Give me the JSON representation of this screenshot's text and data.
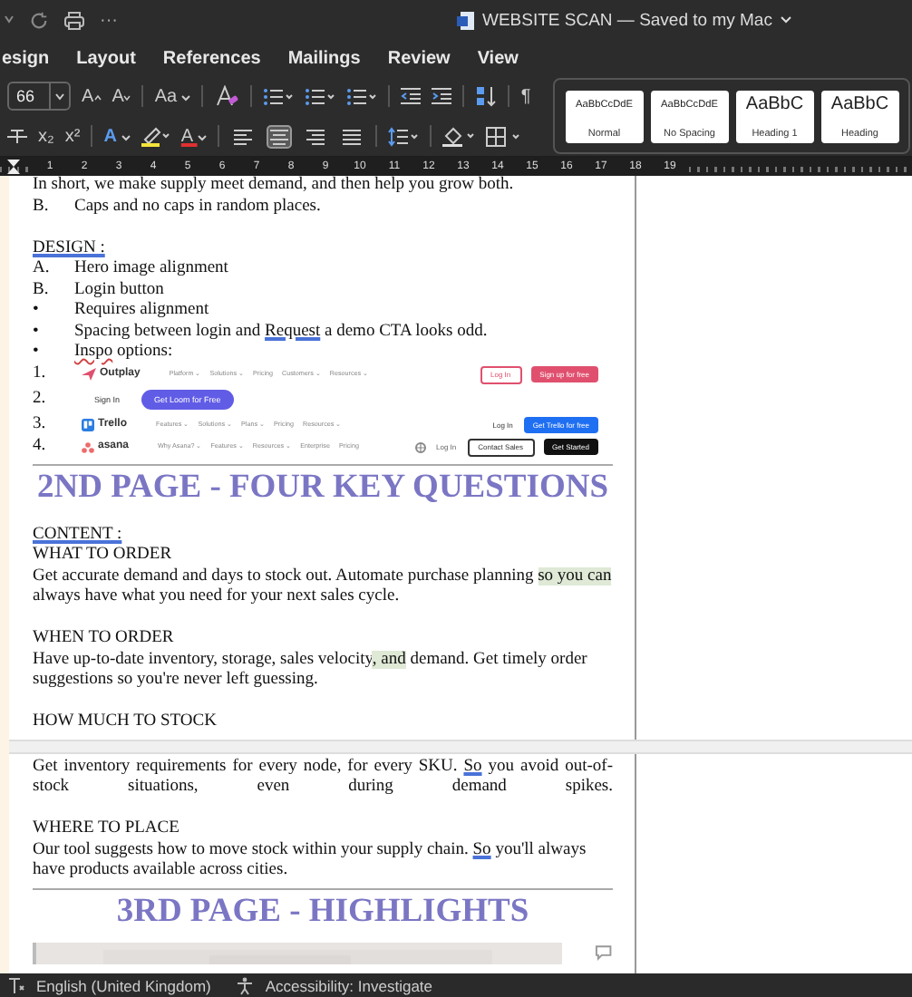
{
  "title_bar": {
    "more": "···",
    "title": "WEBSITE SCAN — Saved to my Mac"
  },
  "menu_tabs": [
    "esign",
    "Layout",
    "References",
    "Mailings",
    "Review",
    "View"
  ],
  "ribbon": {
    "font_size": "66",
    "grow_font": "A",
    "shrink_font": "A",
    "change_case": "Aa",
    "subscript": "x₂",
    "superscript": "x²",
    "text_effects": "A",
    "font_color": "A",
    "show_marks": "¶",
    "alignment": [
      {
        "selected": false
      },
      {
        "selected": true
      },
      {
        "selected": false
      },
      {
        "selected": false
      }
    ],
    "styles": [
      {
        "preview": "AaBbCcDdE",
        "name": "Normal"
      },
      {
        "preview": "AaBbCcDdE",
        "name": "No Spacing"
      },
      {
        "preview": "AaBbC",
        "name": "Heading 1"
      },
      {
        "preview": "AaBbC",
        "name": "Heading"
      }
    ]
  },
  "ruler": [
    "1",
    "2",
    "3",
    "4",
    "5",
    "6",
    "7",
    "8",
    "9",
    "10",
    "11",
    "12",
    "13",
    "14",
    "15",
    "16",
    "17",
    "18",
    "19"
  ],
  "document": [
    {
      "kind": "cut_line",
      "segments": [
        {
          "text": "In short, we make supply meet demand, and then help you grow both."
        }
      ]
    },
    {
      "kind": "list",
      "marker": "B.",
      "segments": [
        {
          "text": "Caps and no caps in random places."
        }
      ]
    },
    {
      "kind": "gap"
    },
    {
      "kind": "para",
      "segments": [
        {
          "text": "DESIGN :",
          "underline": true
        }
      ]
    },
    {
      "kind": "list",
      "marker": "A.",
      "segments": [
        {
          "text": "Hero image alignment"
        }
      ]
    },
    {
      "kind": "list",
      "marker": "B.",
      "segments": [
        {
          "text": "Login button"
        }
      ]
    },
    {
      "kind": "list",
      "marker": "•",
      "segments": [
        {
          "text": "Requires alignment"
        }
      ]
    },
    {
      "kind": "list",
      "marker": "•",
      "segments": [
        {
          "text": "Spacing between login and "
        },
        {
          "text": "Request",
          "flag": true
        },
        {
          "text": " a demo CTA looks odd."
        }
      ]
    },
    {
      "kind": "list",
      "marker": "•",
      "segments": [
        {
          "text": "Inspo",
          "spell": true
        },
        {
          "text": " options:"
        }
      ]
    },
    {
      "kind": "inspo",
      "items": [
        {
          "marker": "1.",
          "logo": "Outplay",
          "nav": [
            "Platform ⌄",
            "Solutions ⌄",
            "Pricing",
            "Customers ⌄",
            "Resources ⌄"
          ],
          "buttons": [
            "Log In",
            "Sign up for free"
          ]
        },
        {
          "marker": "2.",
          "buttons": [
            "Sign In",
            "Get Loom for Free"
          ]
        },
        {
          "marker": "3.",
          "logo": "Trello",
          "nav": [
            "Features ⌄",
            "Solutions ⌄",
            "Plans ⌄",
            "Pricing",
            "Resources ⌄"
          ],
          "buttons": [
            "Log In",
            "Get Trello for free"
          ]
        },
        {
          "marker": "4.",
          "logo": "asana",
          "nav": [
            "Why Asana? ⌄",
            "Features ⌄",
            "Resources ⌄",
            "Enterprise",
            "Pricing"
          ],
          "buttons": [
            "Log In",
            "Contact Sales",
            "Get Started"
          ]
        }
      ]
    },
    {
      "kind": "rule"
    },
    {
      "kind": "heading",
      "text": "2ND PAGE - FOUR KEY QUESTIONS"
    },
    {
      "kind": "gap_small"
    },
    {
      "kind": "para",
      "segments": [
        {
          "text": "CONTENT :",
          "underline": true
        }
      ]
    },
    {
      "kind": "para",
      "segments": [
        {
          "text": "WHAT TO ORDER"
        }
      ]
    },
    {
      "kind": "para",
      "segments": [
        {
          "text": "Get accurate demand and days to stock out. Automate purchase planning "
        },
        {
          "text": "so you can",
          "highlight": true
        },
        {
          "text": " always have what you need for your next sales cycle."
        }
      ]
    },
    {
      "kind": "gap"
    },
    {
      "kind": "para",
      "segments": [
        {
          "text": "WHEN TO ORDER"
        }
      ]
    },
    {
      "kind": "para",
      "segments": [
        {
          "text": "Have up-to-date inventory, storage, sales velocity"
        },
        {
          "text": ", and",
          "highlight": true
        },
        {
          "text": " demand. Get timely order suggestions so you're never left guessing."
        }
      ]
    },
    {
      "kind": "gap"
    },
    {
      "kind": "para",
      "segments": [
        {
          "text": "HOW MUCH TO STOCK"
        }
      ]
    },
    {
      "kind": "page_break"
    },
    {
      "kind": "justified",
      "segments": [
        {
          "text": "Get inventory requirements for every node, for every SKU. "
        },
        {
          "text": "So",
          "flag": true
        },
        {
          "text": " you avoid out-of-stock situations, even during demand spikes."
        }
      ]
    },
    {
      "kind": "gap"
    },
    {
      "kind": "para",
      "segments": [
        {
          "text": "WHERE TO PLACE"
        }
      ]
    },
    {
      "kind": "para",
      "segments": [
        {
          "text": "Our tool suggests how to move stock within your supply chain. "
        },
        {
          "text": "So",
          "flag": true
        },
        {
          "text": " you'll always have products available across cities."
        }
      ]
    },
    {
      "kind": "rule"
    },
    {
      "kind": "heading",
      "text": "3RD PAGE - HIGHLIGHTS"
    },
    {
      "kind": "picture"
    }
  ],
  "status_bar": {
    "language": "English (United Kingdom)",
    "accessibility": "Accessibility: Investigate"
  }
}
